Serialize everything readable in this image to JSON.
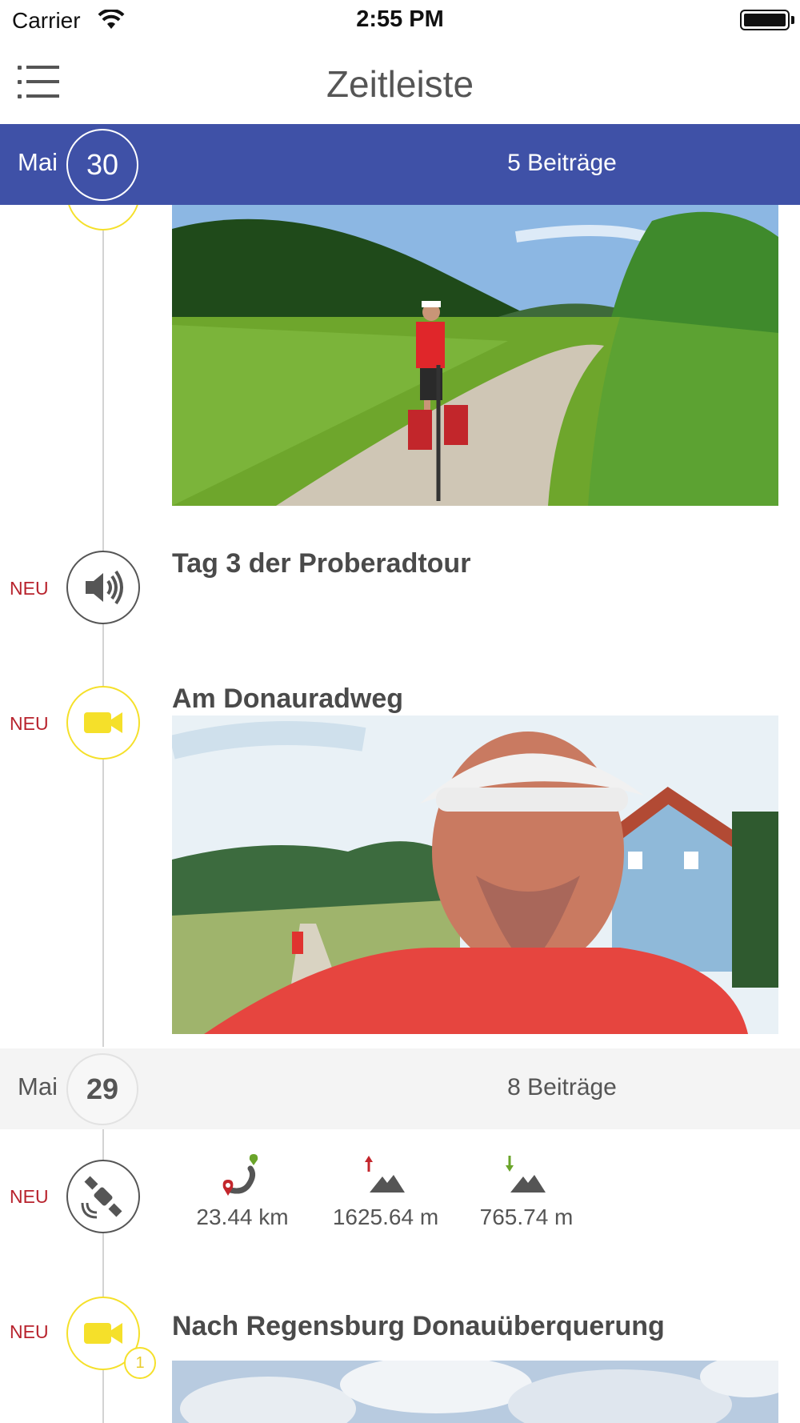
{
  "status_bar": {
    "carrier": "Carrier",
    "time": "2:55 PM"
  },
  "nav": {
    "title": "Zeitleiste",
    "menu_icon": "list-menu-icon"
  },
  "days": [
    {
      "month": "Mai",
      "day": "30",
      "count": "5 Beiträge"
    },
    {
      "month": "Mai",
      "day": "29",
      "count": "8 Beiträge"
    }
  ],
  "entries": [
    {
      "tag": "NEU",
      "type": "audio",
      "icon": "speaker-icon",
      "title": "Tag 3 der Proberadtour"
    },
    {
      "tag": "NEU",
      "type": "video",
      "icon": "video-camera-icon",
      "title": "Am Donauradweg"
    },
    {
      "tag": "NEU",
      "type": "track",
      "icon": "satellite-icon",
      "stats": [
        {
          "icon": "route-icon",
          "value": "23.44 km"
        },
        {
          "icon": "ascent-icon",
          "value": "1625.64 m"
        },
        {
          "icon": "descent-icon",
          "value": "765.74 m"
        }
      ]
    },
    {
      "tag": "NEU",
      "type": "video",
      "icon": "video-camera-icon",
      "title": "Nach Regensburg Donauüberquerung",
      "badge": "1"
    }
  ],
  "colors": {
    "header_active": "#3f51a7",
    "neu_red": "#b8232d",
    "video_yellow": "#f5e02a"
  }
}
